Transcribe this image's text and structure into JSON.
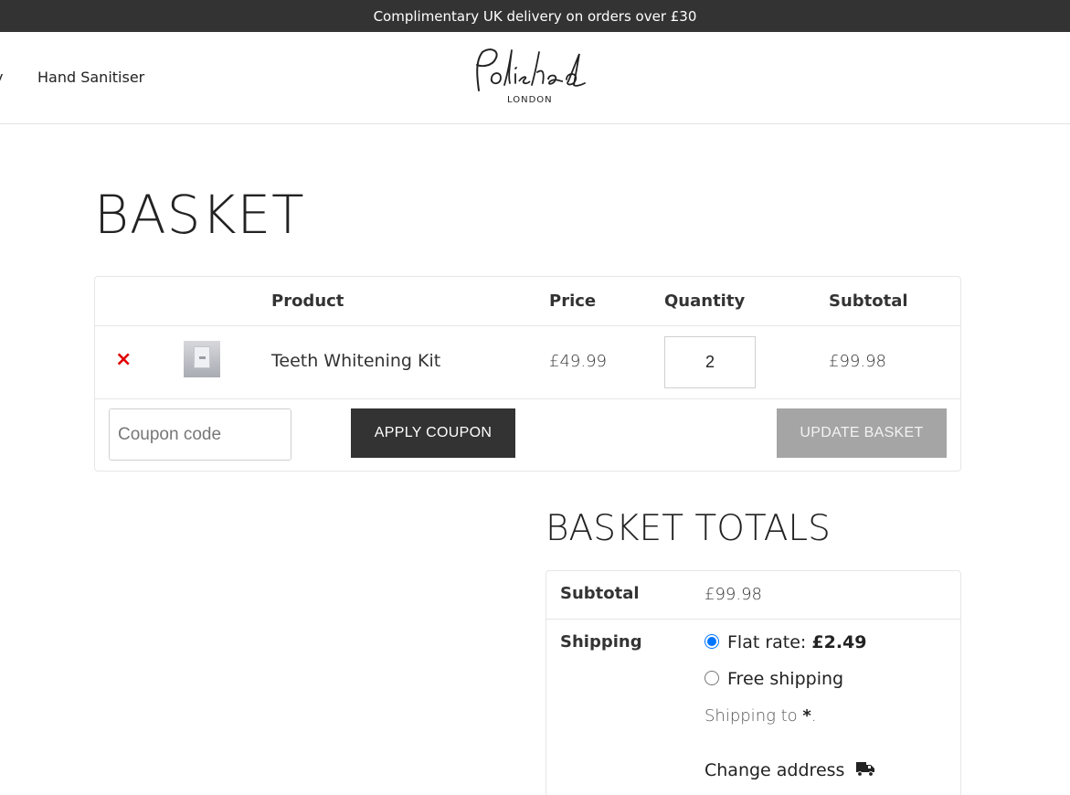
{
  "announcement": "Complimentary UK delivery on orders over £30",
  "nav": {
    "cut_item": "y",
    "items": [
      "Hand Sanitiser"
    ]
  },
  "logo": {
    "script": "Polished",
    "sub": "LONDON"
  },
  "page_title": "BASKET",
  "cart": {
    "headers": {
      "product": "Product",
      "price": "Price",
      "quantity": "Quantity",
      "subtotal": "Subtotal"
    },
    "items": [
      {
        "remove": "×",
        "name": "Teeth Whitening Kit",
        "price": "£49.99",
        "quantity": "2",
        "subtotal": "£99.98"
      }
    ],
    "coupon_placeholder": "Coupon code",
    "apply_label": "APPLY COUPON",
    "update_label": "UPDATE BASKET"
  },
  "totals": {
    "title": "BASKET TOTALS",
    "subtotal_label": "Subtotal",
    "subtotal_value": "£99.98",
    "shipping_label": "Shipping",
    "options": [
      {
        "label": "Flat rate: ",
        "amount": "£2.49",
        "selected": true
      },
      {
        "label": "Free shipping",
        "amount": "",
        "selected": false
      }
    ],
    "shipping_to_prefix": "Shipping to ",
    "shipping_to_dest": "*",
    "shipping_to_suffix": ".",
    "change_address": "Change address",
    "change_icon": "truck-icon"
  },
  "colors": {
    "announcement_bg": "#333333",
    "apply_bg": "#333333",
    "update_bg": "#a5a5a5",
    "remove": "#e00000",
    "radio": "#0075ff"
  }
}
